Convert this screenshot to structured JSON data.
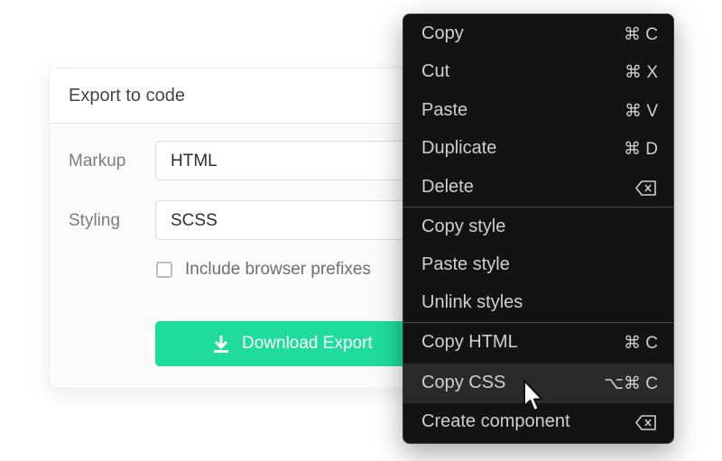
{
  "export_panel": {
    "title": "Export to code",
    "markup_label": "Markup",
    "markup_value": "HTML",
    "styling_label": "Styling",
    "styling_value": "SCSS",
    "prefix_label": "Include browser prefixes",
    "prefix_checked": false,
    "download_label": "Download Export",
    "download_icon": "download-icon",
    "accent_color": "#1fdb9c"
  },
  "context_menu": {
    "background_color": "#131313",
    "groups": [
      [
        {
          "label": "Copy",
          "shortcut": "⌘ C"
        },
        {
          "label": "Cut",
          "shortcut": "⌘ X"
        },
        {
          "label": "Paste",
          "shortcut": "⌘ V"
        },
        {
          "label": "Duplicate",
          "shortcut": "⌘ D"
        },
        {
          "label": "Delete",
          "shortcut_icon": "backspace-icon"
        }
      ],
      [
        {
          "label": "Copy style"
        },
        {
          "label": "Paste style"
        },
        {
          "label": "Unlink styles"
        }
      ],
      [
        {
          "label": "Copy HTML",
          "shortcut": "⌘ C"
        },
        {
          "label": "Copy CSS",
          "shortcut": "⌥⌘ C",
          "highlighted": true
        },
        {
          "label": "Create component",
          "shortcut_icon": "backspace-icon"
        }
      ]
    ]
  }
}
